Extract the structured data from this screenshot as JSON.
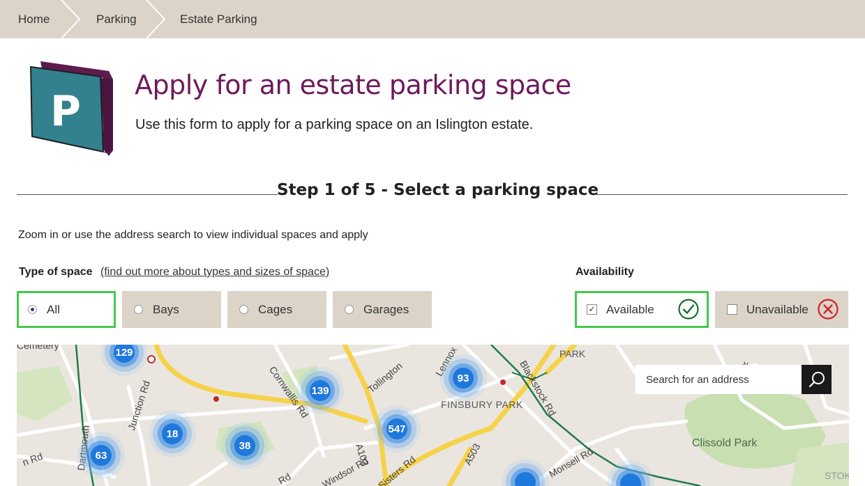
{
  "breadcrumb": [
    {
      "label": "Home"
    },
    {
      "label": "Parking"
    },
    {
      "label": "Estate Parking"
    }
  ],
  "header": {
    "logo_letter": "P",
    "title": "Apply for an estate parking space",
    "intro": "Use this form to apply for a parking space on an Islington estate."
  },
  "step": {
    "title": "Step 1 of 5 - Select a parking space"
  },
  "instructions": "Zoom in or use the address search to view individual spaces and apply",
  "type_of_space": {
    "label": "Type of space",
    "link": "(find out more about types and sizes of space)",
    "options": [
      {
        "label": "All",
        "selected": true
      },
      {
        "label": "Bays",
        "selected": false
      },
      {
        "label": "Cages",
        "selected": false
      },
      {
        "label": "Garages",
        "selected": false
      }
    ]
  },
  "availability": {
    "label": "Availability",
    "options": [
      {
        "label": "Available",
        "checked": true,
        "icon": "check-circle-icon",
        "color": "#1a6e2e"
      },
      {
        "label": "Unavailable",
        "checked": false,
        "icon": "cross-circle-icon",
        "color": "#d4202a"
      }
    ]
  },
  "map": {
    "search_placeholder": "Search for an address",
    "clusters": [
      "129",
      "139",
      "93",
      "18",
      "38",
      "547",
      "63"
    ],
    "labels": [
      "Cemetery",
      "Junction Rd",
      "Cornwallis Rd",
      "Tollington",
      "Lennox",
      "FINSBURY PARK",
      "PARK",
      "Blackstock Rd",
      "A103",
      "A503",
      "Windsor Rd",
      "Sisters Rd",
      "Monsell Rd",
      "Clissold Park",
      "STOK",
      "Dartmouth",
      "n Rd",
      "Park",
      "Rd"
    ],
    "colors": {
      "water_road": "#f6d24a",
      "green": "#c8dfb2",
      "cluster": "#1f78dc",
      "rail": "#1f7a4c"
    }
  },
  "colors": {
    "title": "#6e1a5a",
    "breadcrumb_bg": "#dcd4c8",
    "selected_border": "#45c84c",
    "logo_face": "#33808e",
    "logo_side": "#5e1b4e"
  }
}
